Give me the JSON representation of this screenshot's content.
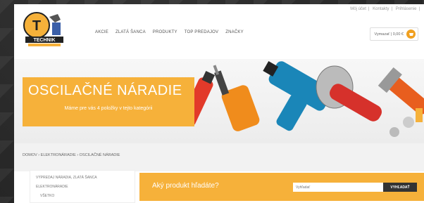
{
  "header": {
    "top_links": [
      "Môj účet",
      "Kontakty",
      "Prihlásenie"
    ],
    "logo_text": "TECHNIK",
    "nav": [
      "AKCIE",
      "ZLATÁ ŠANCA",
      "PRODUKTY",
      "TOP PREDAJOV",
      "ZNAČKY"
    ],
    "cart_label": "Vymazať | 0,00 €"
  },
  "hero": {
    "title": "OSCILAČNÉ NÁRADIE",
    "subtitle": "Máme pre vás 4 položky v tejto kategórii"
  },
  "breadcrumb": "DOMOV › ELEKTRONÁRADIE › OSCILAČNÉ NÁRADIE",
  "sidebar": {
    "items": [
      "VÝPREDAJ NÁRADIA, ZLATÁ ŠANCA",
      "ELEKTRONÁRADIE",
      "VŠETKO"
    ]
  },
  "search": {
    "question": "Aký produkt hľadáte?",
    "placeholder": "Vyhľadať",
    "button": "VYHĽADAŤ"
  },
  "colors": {
    "accent": "#f6b13a",
    "dark": "#333333"
  }
}
